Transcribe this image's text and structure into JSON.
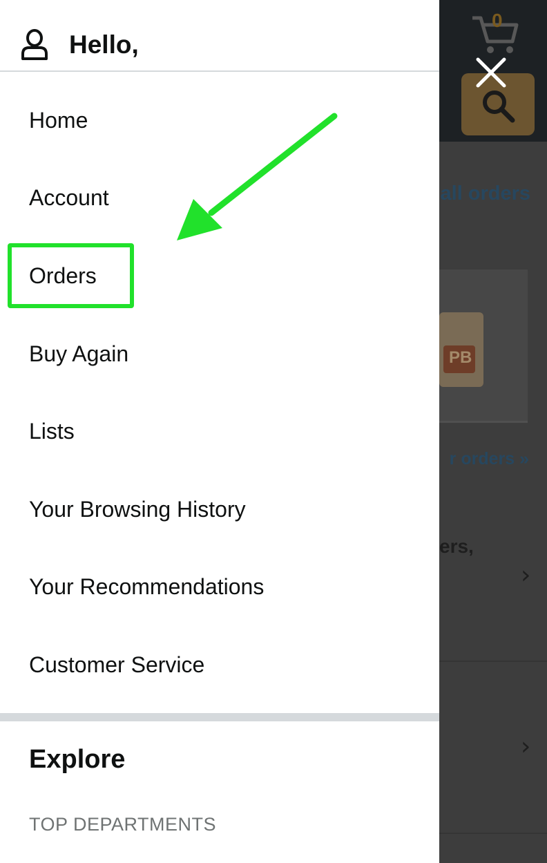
{
  "background": {
    "cart_count": "0",
    "orders_link": "all orders",
    "more_orders_link": "r orders »",
    "partial_text": "ers,",
    "product_label": "PB"
  },
  "drawer": {
    "greeting": "Hello,",
    "menu": [
      {
        "label": "Home"
      },
      {
        "label": "Account"
      },
      {
        "label": "Orders"
      },
      {
        "label": "Buy Again"
      },
      {
        "label": "Lists"
      },
      {
        "label": "Your Browsing History"
      },
      {
        "label": "Your Recommendations"
      },
      {
        "label": "Customer Service"
      }
    ],
    "explore_title": "Explore",
    "section_label": "TOP DEPARTMENTS"
  },
  "icons": {
    "user": "user-icon",
    "close": "close-icon",
    "cart": "cart-icon",
    "search": "search-icon",
    "chevron": "chevron-right-icon",
    "annotation_arrow": "arrow-icon"
  },
  "colors": {
    "highlight": "#21e12b",
    "link": "#27475f",
    "text": "#0f1111",
    "muted": "#6f7373"
  }
}
